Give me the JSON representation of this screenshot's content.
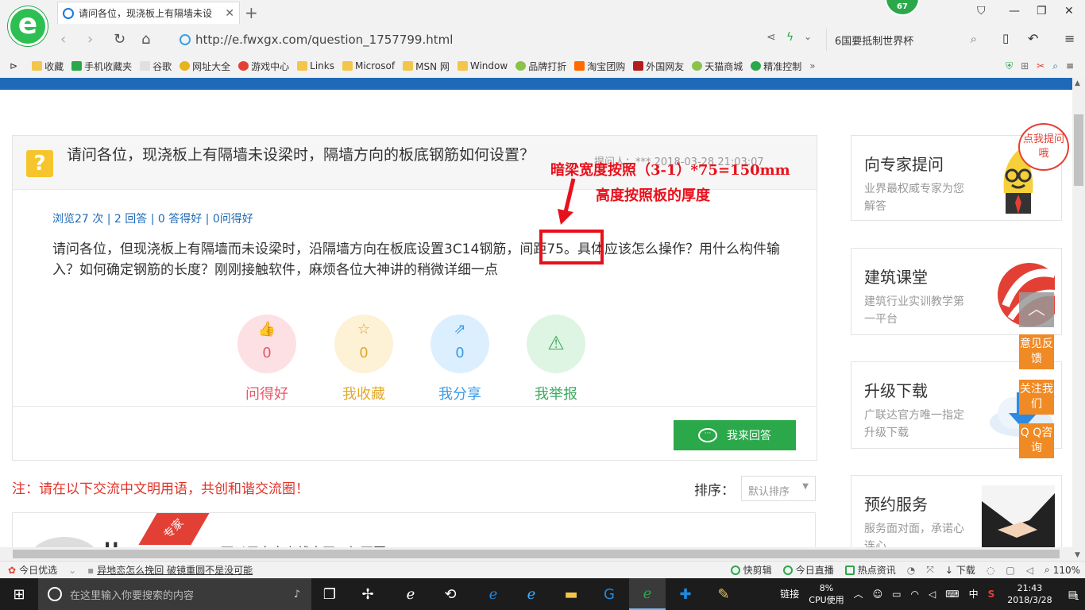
{
  "browser": {
    "tab_title": "请问各位，现浇板上有隔墙未设",
    "badge_count": "67",
    "url": "http://e.fwxgx.com/question_1757799.html",
    "search_text": "6国要抵制世界杯"
  },
  "bookmarks": [
    {
      "label": "收藏",
      "color": "#f3c54a"
    },
    {
      "label": "手机收藏夹",
      "color": "#2aa84a"
    },
    {
      "label": "谷歌",
      "color": "#cccccc"
    },
    {
      "label": "网址大全",
      "color": "#e8b31b"
    },
    {
      "label": "游戏中心",
      "color": "#e34035"
    },
    {
      "label": "Links",
      "color": "#f3c54a"
    },
    {
      "label": "Microsof",
      "color": "#f3c54a"
    },
    {
      "label": "MSN 网",
      "color": "#f3c54a"
    },
    {
      "label": "Window",
      "color": "#f3c54a"
    },
    {
      "label": "品牌打折",
      "color": "#8bc34a"
    },
    {
      "label": "淘宝团购",
      "color": "#ff6a00"
    },
    {
      "label": "外国网友",
      "color": "#b71c1c"
    },
    {
      "label": "天猫商城",
      "color": "#8bc34a"
    },
    {
      "label": "精准控制",
      "color": "#2aa84a"
    }
  ],
  "question": {
    "title": "请问各位，现浇板上有隔墙未设梁时，隔墙方向的板底钢筋如何设置？",
    "meta": "提问人：***  2018-03-28 21:03:07",
    "stats": "浏览27 次 | 2 回答 | 0 答得好 | 0问得好",
    "body": "请问各位，但现浇板上有隔墙而未设梁时，沿隔墙方向在板底设置3C14钢筋，间距75。具体应该怎么操作？用什么构件输入？如何确定钢筋的长度？刚刚接触软件，麻烦各位大神讲的稍微详细一点",
    "actions": [
      {
        "label": "问得好",
        "count": "0",
        "color": "#e3596a",
        "bg": "#fde0e3",
        "icon": "thumbs-up-icon"
      },
      {
        "label": "我收藏",
        "count": "0",
        "color": "#e0a92b",
        "bg": "#fdf1d6",
        "icon": "star-icon"
      },
      {
        "label": "我分享",
        "count": "0",
        "color": "#3a9be8",
        "bg": "#dcefff",
        "icon": "share-icon"
      },
      {
        "label": "我举报",
        "count": "",
        "color": "#3fa860",
        "bg": "#def5e3",
        "icon": "warning-icon"
      }
    ],
    "reply_button": "我来回答"
  },
  "annotation": {
    "line1": "暗梁宽度按照（3-1）*75=150mm",
    "line2": "高度按照板的厚度",
    "color": "#e8101b"
  },
  "notice": "注：请在以下交流中文明用语，共创和谐交流圈！",
  "sort": {
    "label": "排序：",
    "value": "默认排序"
  },
  "answer": {
    "name": "H",
    "text": "可以用自定义线来画，如下图",
    "ribbon": "专家"
  },
  "sidebar": [
    {
      "title": "向专家提问",
      "sub": "业界最权威专家为您解答"
    },
    {
      "title": "建筑课堂",
      "sub": "建筑行业实训教学第一平台"
    },
    {
      "title": "升级下载",
      "sub": "广联达官方唯一指定升级下载"
    },
    {
      "title": "预约服务",
      "sub": "服务面对面，承诺心连心"
    }
  ],
  "bubble": "点我提问哦",
  "float_buttons": [
    "意见反馈",
    "关注我们",
    "Q Q咨询"
  ],
  "statusbar": {
    "left": [
      "今日优选",
      "异地恋怎么挽回 破镜重圆不是没可能"
    ],
    "right": [
      "快剪辑",
      "今日直播",
      "热点资讯",
      "下载",
      "110%"
    ]
  },
  "taskbar": {
    "search_placeholder": "在这里输入你要搜索的内容",
    "link_label": "链接",
    "cpu_pct": "8%",
    "cpu_label": "CPU使用",
    "ime": "中",
    "time": "21:43",
    "date": "2018/3/28",
    "notif_count": "1"
  }
}
